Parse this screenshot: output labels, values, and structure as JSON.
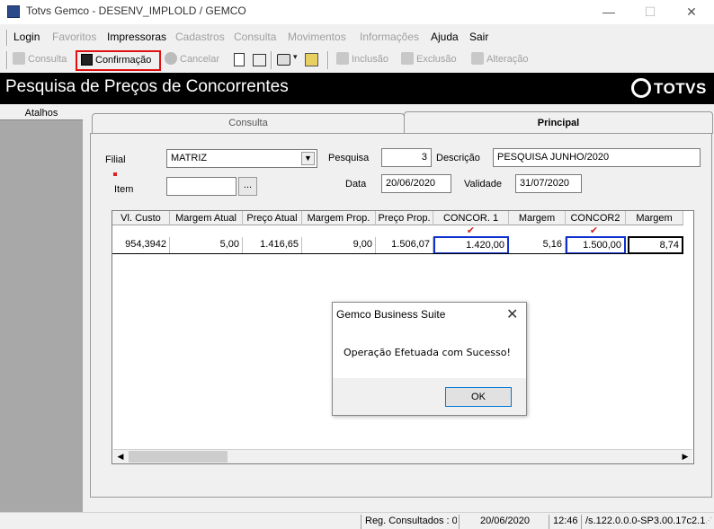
{
  "window": {
    "title": "Totvs Gemco - DESENV_IMPLOLD / GEMCO",
    "minimize_glyph": "—",
    "maximize_glyph": "☐",
    "close_glyph": "✕"
  },
  "menu": {
    "items": [
      {
        "label": "Login",
        "enabled": true
      },
      {
        "label": "Favoritos",
        "enabled": false
      },
      {
        "label": "Impressoras",
        "enabled": true
      },
      {
        "label": "Cadastros",
        "enabled": false
      },
      {
        "label": "Consulta",
        "enabled": false
      },
      {
        "label": "Movimentos",
        "enabled": false
      },
      {
        "label": "Informações",
        "enabled": false
      },
      {
        "label": "Ajuda",
        "enabled": true
      },
      {
        "label": "Sair",
        "enabled": true
      }
    ]
  },
  "toolbar": {
    "consulta_label": "Consulta",
    "confirmacao_label": "Confirmação",
    "cancelar_label": "Cancelar",
    "inclusao_label": "Inclusão",
    "exclusao_label": "Exclusão",
    "alteracao_label": "Alteração",
    "highlight_color": "#e01010"
  },
  "banner": {
    "page_title": "Pesquisa de Preços de Concorrentes",
    "logo_text": "TOTVS"
  },
  "sidebar": {
    "header": "Atalhos"
  },
  "tabs": [
    {
      "label": "Consulta",
      "active": false
    },
    {
      "label": "Principal",
      "active": true
    }
  ],
  "form": {
    "filial_label": "Filial",
    "filial_value": "MATRIZ",
    "item_label": "Item",
    "item_value": "",
    "item_button": "...",
    "pesquisa_label": "Pesquisa",
    "pesquisa_value": "3",
    "descricao_label": "Descrição",
    "descricao_value": "PESQUISA JUNHO/2020",
    "data_label": "Data",
    "data_value": "20/06/2020",
    "validade_label": "Validade",
    "validade_value": "31/07/2020"
  },
  "grid": {
    "columns": [
      "Vl. Custo",
      "Margem Atual",
      "Preço Atual",
      "Margem Prop.",
      "Preço Prop.",
      "CONCOR. 1",
      "Margem",
      "CONCOR2",
      "Margem"
    ],
    "row": [
      "954,3942",
      "5,00",
      "1.416,65",
      "9,00",
      "1.506,07",
      "1.420,00",
      "5,16",
      "1.500,00",
      "8,74"
    ],
    "check_glyph": "✔",
    "highlight_color": "#1030d0"
  },
  "dialog": {
    "title": "Gemco Business Suite",
    "message": "Operação Efetuada com Sucesso!",
    "ok_label": "OK",
    "close_glyph": "✕"
  },
  "status": {
    "reg_consultados": "Reg. Consultados : 0",
    "date": "20/06/2020",
    "time": "12:46",
    "version": "/s.122.0.0.0-SP3.00.17c2.1"
  }
}
